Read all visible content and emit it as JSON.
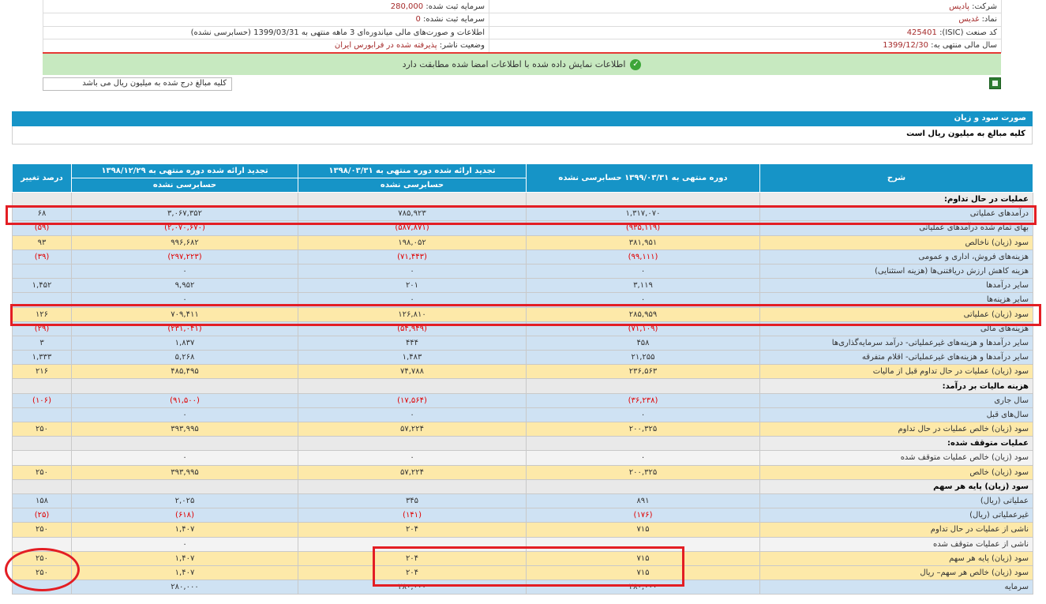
{
  "info": {
    "rows": [
      {
        "r_label": "شرکت:",
        "r_value": "پادیس",
        "l_label": "سرمایه ثبت شده:",
        "l_value": "280,000"
      },
      {
        "r_label": "نماد:",
        "r_value": "غدیس",
        "l_label": "سرمایه ثبت نشده:",
        "l_value": "0"
      },
      {
        "r_label": "کد صنعت (ISIC):",
        "r_value": "425401",
        "l_label": "اطلاعات و صورت‌های مالی میاندوره‌ای 3 ماهه منتهی به 1399/03/31 (حسابرسی نشده)",
        "l_value": ""
      },
      {
        "r_label": "سال مالی منتهی به:",
        "r_value": "1399/12/30",
        "l_label": "وضعیت ناشر:",
        "l_value": "پذیرفته شده در فرابورس ایران"
      }
    ]
  },
  "banner": {
    "text": "اطلاعات نمایش داده شده با اطلاعات امضا شده مطابقت دارد"
  },
  "note": "کلیه مبالغ درج شده به میلیون ریال می باشد",
  "section": {
    "title": "صورت سود و زیان",
    "subtitle": "کلیه مبالغ به میلیون ریال است"
  },
  "table": {
    "headers": {
      "desc": "شرح",
      "c1": "دوره منتهی به ۱۳۹۹/۰۳/۳۱ حسابرسی نشده",
      "c2a": "تجدید ارائه شده دوره منتهی به ۱۳۹۸/۰۳/۳۱",
      "c2b": "حسابرسی نشده",
      "c3a": "تجدید ارائه شده دوره منتهی به ۱۳۹۸/۱۲/۲۹",
      "c3b": "حسابرسی نشده",
      "c4": "درصد تغییر"
    },
    "rows": [
      {
        "t": "s",
        "d": "عملیات در حال تداوم:"
      },
      {
        "t": "b",
        "d": "درآمدهای عملیاتی",
        "v1": "۱,۳۱۷,۰۷۰",
        "v2": "۷۸۵,۹۲۳",
        "v3": "۳,۰۶۷,۳۵۲",
        "v4": "۶۸"
      },
      {
        "t": "b",
        "d": "بهای تمام شده درآمدهای عملیاتی",
        "v1": "(۹۳۵,۱۱۹)",
        "v2": "(۵۸۷,۸۷۱)",
        "v3": "(۲,۰۷۰,۶۷۰)",
        "v4": "(۵۹)",
        "neg": true
      },
      {
        "t": "y",
        "d": "سود (زیان) ناخالص",
        "v1": "۳۸۱,۹۵۱",
        "v2": "۱۹۸,۰۵۲",
        "v3": "۹۹۶,۶۸۲",
        "v4": "۹۳"
      },
      {
        "t": "b",
        "d": "هزینه‌های فروش، اداری و عمومی",
        "v1": "(۹۹,۱۱۱)",
        "v2": "(۷۱,۴۴۳)",
        "v3": "(۲۹۷,۲۲۳)",
        "v4": "(۳۹)",
        "neg": true
      },
      {
        "t": "b",
        "d": "هزینه کاهش ارزش دریافتنی‌ها (هزینه استثنایی)",
        "v1": "۰",
        "v2": "۰",
        "v3": "۰",
        "v4": ""
      },
      {
        "t": "b",
        "d": "سایر درآمدها",
        "v1": "۳,۱۱۹",
        "v2": "۲۰۱",
        "v3": "۹,۹۵۲",
        "v4": "۱,۴۵۲"
      },
      {
        "t": "b",
        "d": "سایر هزینه‌ها",
        "v1": "۰",
        "v2": "۰",
        "v3": "۰",
        "v4": ""
      },
      {
        "t": "y",
        "d": "سود (زیان) عملیاتی",
        "v1": "۲۸۵,۹۵۹",
        "v2": "۱۲۶,۸۱۰",
        "v3": "۷۰۹,۴۱۱",
        "v4": "۱۲۶"
      },
      {
        "t": "b",
        "d": "هزینه‌های مالی",
        "v1": "(۷۱,۱۰۹)",
        "v2": "(۵۴,۹۴۹)",
        "v3": "(۲۳۱,۰۴۱)",
        "v4": "(۲۹)",
        "neg": true
      },
      {
        "t": "b",
        "d": "سایر درآمدها و هزینه‌های غیرعملیاتی- درآمد سرمایه‌گذاری‌ها",
        "v1": "۴۵۸",
        "v2": "۴۴۴",
        "v3": "۱,۸۳۷",
        "v4": "۳"
      },
      {
        "t": "b",
        "d": "سایر درآمدها و هزینه‌های غیرعملیاتی- اقلام متفرقه",
        "v1": "۲۱,۲۵۵",
        "v2": "۱,۴۸۳",
        "v3": "۵,۲۶۸",
        "v4": "۱,۳۳۳"
      },
      {
        "t": "y",
        "d": "سود (زیان) عملیات در حال تداوم قبل از مالیات",
        "v1": "۲۳۶,۵۶۳",
        "v2": "۷۴,۷۸۸",
        "v3": "۴۸۵,۴۹۵",
        "v4": "۲۱۶"
      },
      {
        "t": "s",
        "d": "هزینه مالیات بر درآمد:"
      },
      {
        "t": "b",
        "d": "سال جاری",
        "v1": "(۳۶,۲۳۸)",
        "v2": "(۱۷,۵۶۴)",
        "v3": "(۹۱,۵۰۰)",
        "v4": "(۱۰۶)",
        "neg": true
      },
      {
        "t": "b",
        "d": "سال‌های قبل",
        "v1": "۰",
        "v2": "۰",
        "v3": "۰",
        "v4": ""
      },
      {
        "t": "y",
        "d": "سود (زیان) خالص عملیات در حال تداوم",
        "v1": "۲۰۰,۳۲۵",
        "v2": "۵۷,۲۲۴",
        "v3": "۳۹۳,۹۹۵",
        "v4": "۲۵۰"
      },
      {
        "t": "s",
        "d": "عملیات متوقف شده:"
      },
      {
        "t": "w",
        "d": "سود (زیان) خالص عملیات متوقف شده",
        "v1": "۰",
        "v2": "۰",
        "v3": "۰",
        "v4": ""
      },
      {
        "t": "y",
        "d": "سود (زیان) خالص",
        "v1": "۲۰۰,۳۲۵",
        "v2": "۵۷,۲۲۴",
        "v3": "۳۹۳,۹۹۵",
        "v4": "۲۵۰"
      },
      {
        "t": "s",
        "d": "سود (زیان) پایه هر سهم"
      },
      {
        "t": "b",
        "d": "عملیاتی (ریال)",
        "v1": "۸۹۱",
        "v2": "۳۴۵",
        "v3": "۲,۰۲۵",
        "v4": "۱۵۸"
      },
      {
        "t": "b",
        "d": "غیرعملیاتی (ریال)",
        "v1": "(۱۷۶)",
        "v2": "(۱۴۱)",
        "v3": "(۶۱۸)",
        "v4": "(۲۵)",
        "neg": true
      },
      {
        "t": "y",
        "d": "ناشی از عملیات در حال تداوم",
        "v1": "۷۱۵",
        "v2": "۲۰۴",
        "v3": "۱,۴۰۷",
        "v4": "۲۵۰"
      },
      {
        "t": "w",
        "d": "ناشی از عملیات متوقف شده",
        "v1": "",
        "v2": "",
        "v3": "۰",
        "v4": ""
      },
      {
        "t": "y",
        "d": "سود (زیان) پایه هر سهم",
        "v1": "۷۱۵",
        "v2": "۲۰۴",
        "v3": "۱,۴۰۷",
        "v4": "۲۵۰"
      },
      {
        "t": "y",
        "d": "سود (زیان) خالص هر سهم– ریال",
        "v1": "۷۱۵",
        "v2": "۲۰۴",
        "v3": "۱,۴۰۷",
        "v4": "۲۵۰"
      },
      {
        "t": "b",
        "d": "سرمایه",
        "v1": "۲۸۰,۰۰۰",
        "v2": "۲۸۰,۰۰۰",
        "v3": "۲۸۰,۰۰۰",
        "v4": ""
      }
    ]
  },
  "annotations": {
    "color": "#e31e24"
  }
}
